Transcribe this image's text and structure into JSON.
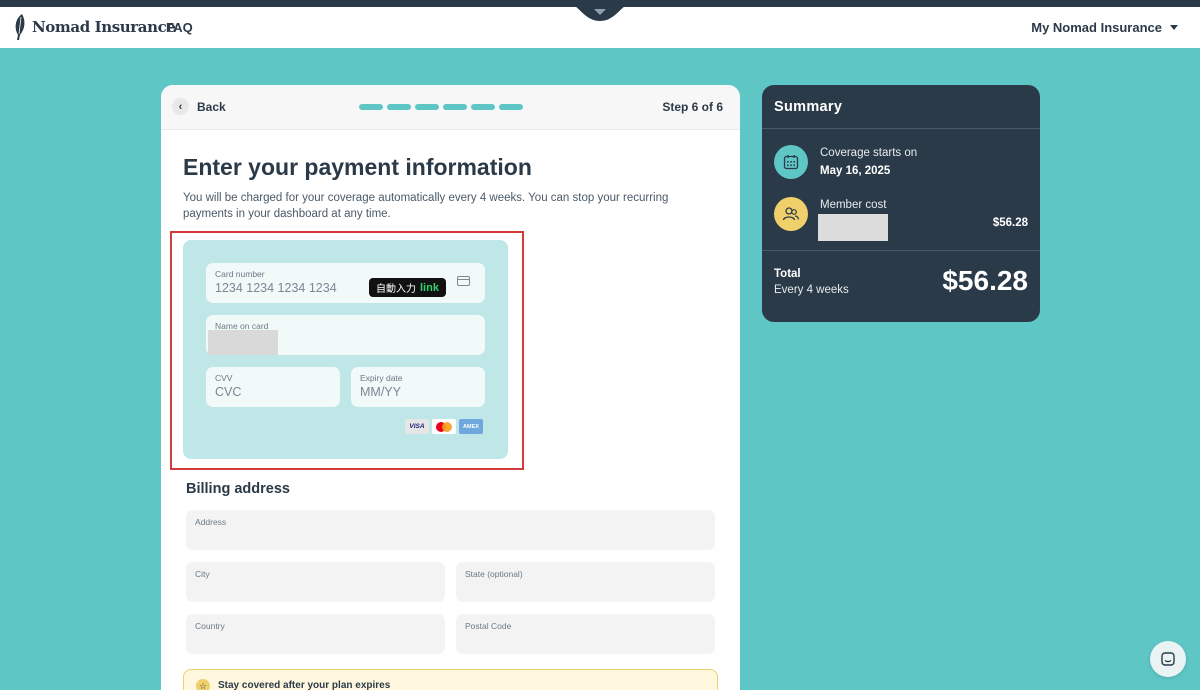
{
  "header": {
    "brand": "Nomad Insurance",
    "faq_label": "FAQ",
    "account_label": "My Nomad Insurance"
  },
  "step": {
    "back_label": "Back",
    "progress_total": 6,
    "progress_current": 6,
    "step_label": "Step 6 of 6"
  },
  "page": {
    "title": "Enter your payment information",
    "description": "You will be charged for your coverage automatically every 4 weeks. You can stop your recurring payments in your dashboard at any time."
  },
  "payment": {
    "card_number_label": "Card number",
    "card_number_placeholder": "1234 1234 1234 1234",
    "autofill_label": "自動入力",
    "autofill_brand": "link",
    "name_label": "Name on card",
    "cvv_label": "CVV",
    "cvv_placeholder": "CVC",
    "expiry_label": "Expiry date",
    "expiry_placeholder": "MM/YY",
    "brands": [
      "VISA",
      "Mastercard",
      "AMEX"
    ]
  },
  "billing": {
    "heading": "Billing address",
    "address_label": "Address",
    "city_label": "City",
    "state_label": "State (optional)",
    "country_label": "Country",
    "postal_label": "Postal Code"
  },
  "notice": {
    "text": "Stay covered after your plan expires"
  },
  "summary": {
    "title": "Summary",
    "coverage_label": "Coverage starts on",
    "coverage_date": "May 16, 2025",
    "member_label": "Member cost",
    "member_cost": "$56.28",
    "total_label": "Total",
    "total_period": "Every 4 weeks",
    "total_amount": "$56.28"
  },
  "colors": {
    "background": "#5fc6c6",
    "navy": "#2b3a48",
    "payment_panel": "#bfe7e8",
    "highlight": "#d63a3a",
    "accent_yellow": "#f0d06b"
  }
}
